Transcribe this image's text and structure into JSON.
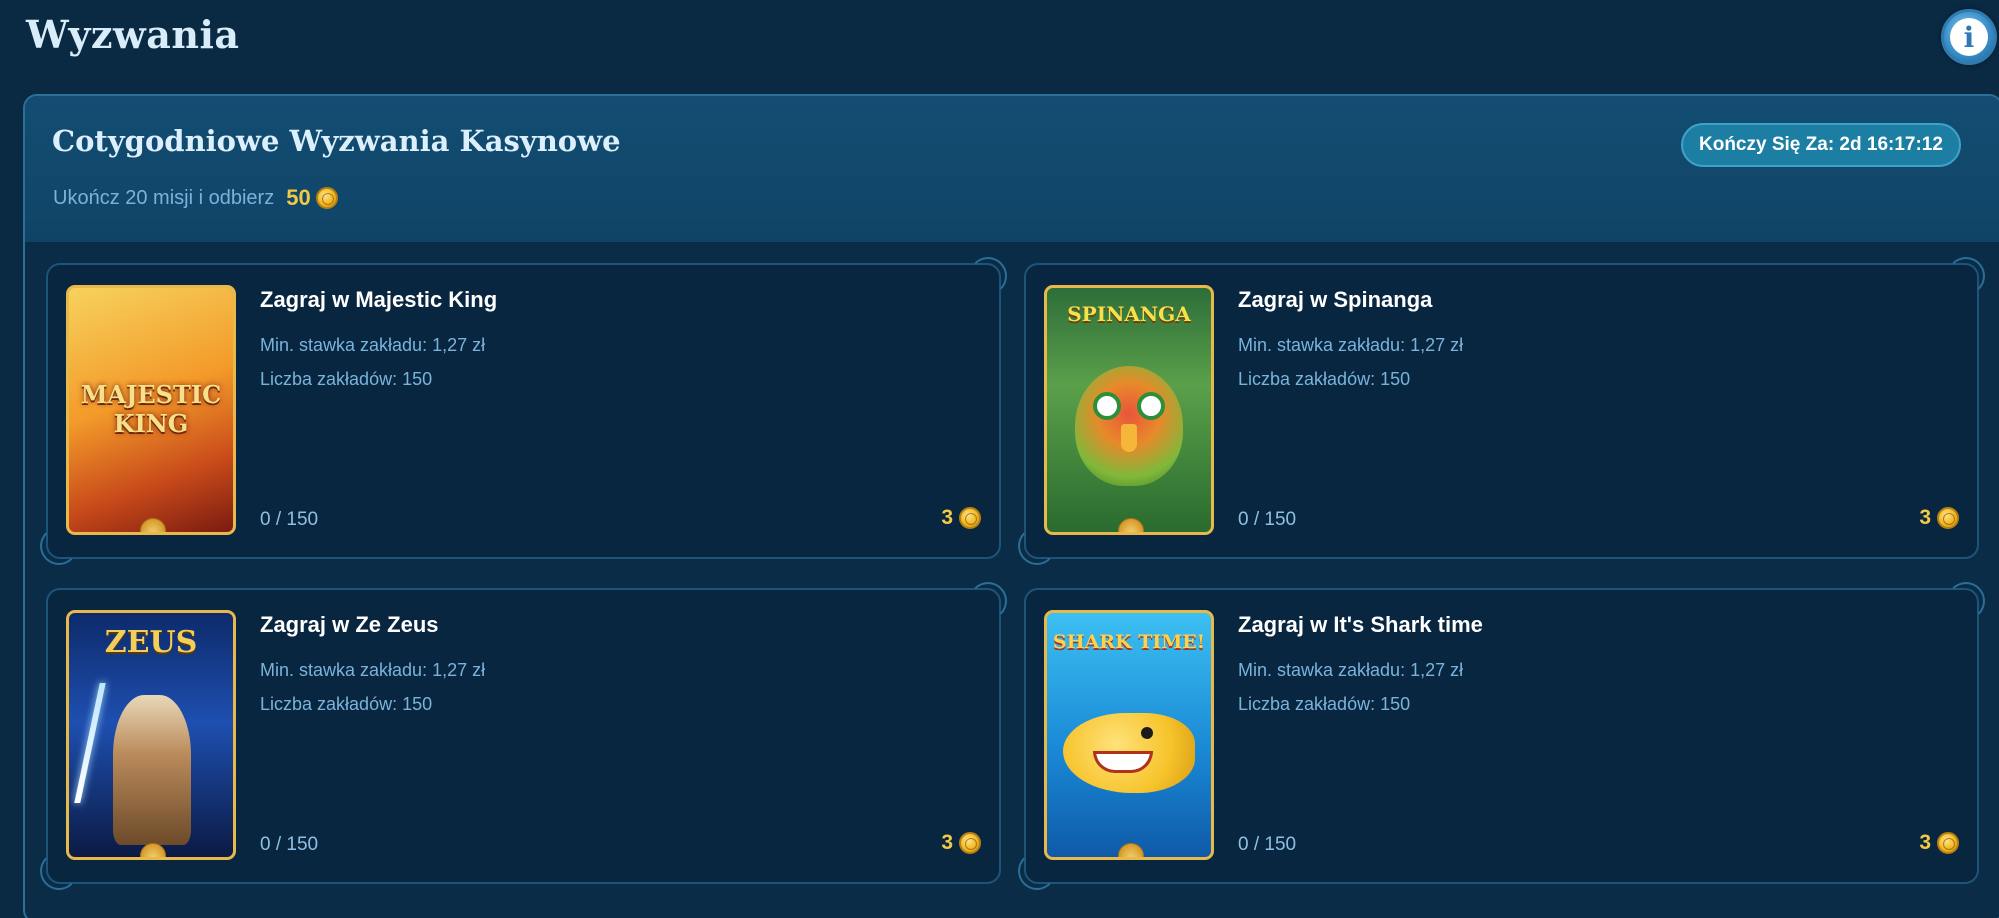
{
  "header": {
    "title": "Wyzwania",
    "info_icon": "i"
  },
  "panel": {
    "title": "Cotygodniowe Wyzwania Kasynowe",
    "timer": "Kończy Się Za: 2d 16:17:12",
    "subtitle": "Ukończ 20 misji i odbierz",
    "reward_amount": "50"
  },
  "challenges": [
    {
      "title": "Zagraj w Majestic King",
      "min_bet": "Min. stawka zakładu: 1,27 zł",
      "bets": "Liczba zakładów: 150",
      "progress": "0 / 150",
      "reward": "3",
      "thumb_label": "MAJESTIC KING",
      "thumb_color": "#f39a2a"
    },
    {
      "title": "Zagraj w Spinanga",
      "min_bet": "Min. stawka zakładu: 1,27 zł",
      "bets": "Liczba zakładów: 150",
      "progress": "0 / 150",
      "reward": "3",
      "thumb_label": "SPINANGA",
      "thumb_color": "#5aa04a"
    },
    {
      "title": "Zagraj w Ze Zeus",
      "min_bet": "Min. stawka zakładu: 1,27 zł",
      "bets": "Liczba zakładów: 150",
      "progress": "0 / 150",
      "reward": "3",
      "thumb_label": "ZEUS",
      "thumb_color": "#1e4fb0"
    },
    {
      "title": "Zagraj w It's Shark time",
      "min_bet": "Min. stawka zakładu: 1,27 zł",
      "bets": "Liczba zakładów: 150",
      "progress": "0 / 150",
      "reward": "3",
      "thumb_label": "SHARK TIME!",
      "thumb_color": "#1a8ad6"
    }
  ]
}
